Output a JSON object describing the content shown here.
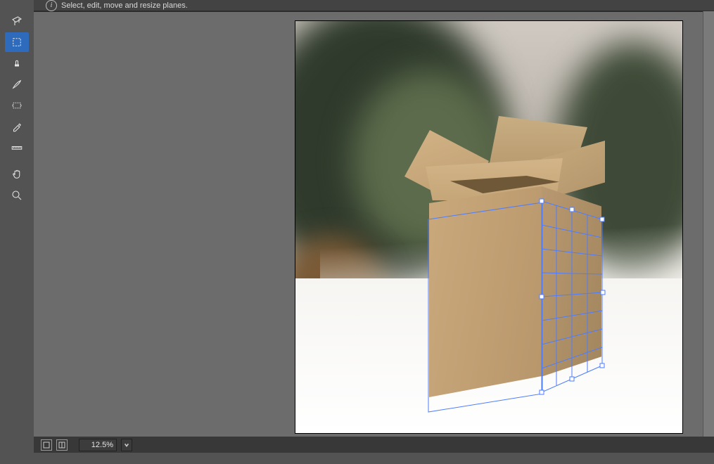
{
  "info_tip": "Select, edit, move and resize planes.",
  "status": {
    "zoom": "12.5%"
  },
  "tools": [
    {
      "name": "edit-plane-tool",
      "selected": false
    },
    {
      "name": "create-plane-tool",
      "selected": true
    },
    {
      "name": "stamp-tool",
      "selected": false
    },
    {
      "name": "brush-tool",
      "selected": false
    },
    {
      "name": "transform-tool",
      "selected": false
    },
    {
      "name": "eyedropper-tool",
      "selected": false
    },
    {
      "name": "measure-tool",
      "selected": false
    },
    {
      "name": "hand-tool",
      "selected": false
    },
    {
      "name": "zoom-tool",
      "selected": false
    }
  ]
}
